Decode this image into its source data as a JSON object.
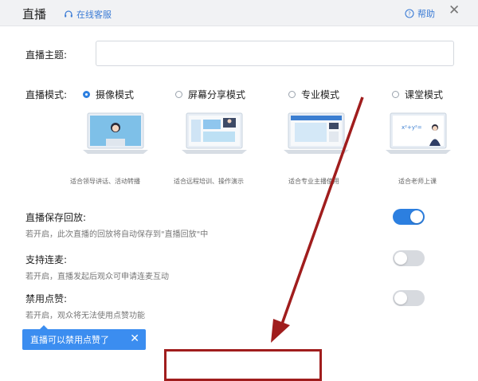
{
  "header": {
    "title": "直播",
    "customer_service": "在线客服",
    "help": "帮助",
    "close": "✕"
  },
  "topic": {
    "label": "直播主题:",
    "value": "",
    "placeholder": ""
  },
  "mode": {
    "label": "直播模式:",
    "options": [
      {
        "label": "摄像模式",
        "caption": "适合领导讲话、活动转播",
        "checked": true
      },
      {
        "label": "屏幕分享模式",
        "caption": "适合远程培训、操作演示",
        "checked": false
      },
      {
        "label": "专业模式",
        "caption": "适合专业主播使用",
        "checked": false
      },
      {
        "label": "课堂模式",
        "caption": "适合老师上课",
        "checked": false
      }
    ]
  },
  "settings": [
    {
      "label": "直播保存回放:",
      "desc": "若开启，此次直播的回放将自动保存到\"直播回放\"中",
      "on": true
    },
    {
      "label": "支持连麦:",
      "desc": "若开启，直播发起后观众可申请连麦互动",
      "on": false
    },
    {
      "label": "禁用点赞:",
      "desc": "若开启，观众将无法使用点赞功能",
      "on": false
    }
  ],
  "tooltip": {
    "text": "直播可以禁用点赞了",
    "close": "✕"
  },
  "colors": {
    "accent": "#2c7fe0",
    "annotation": "#a01d1d"
  }
}
